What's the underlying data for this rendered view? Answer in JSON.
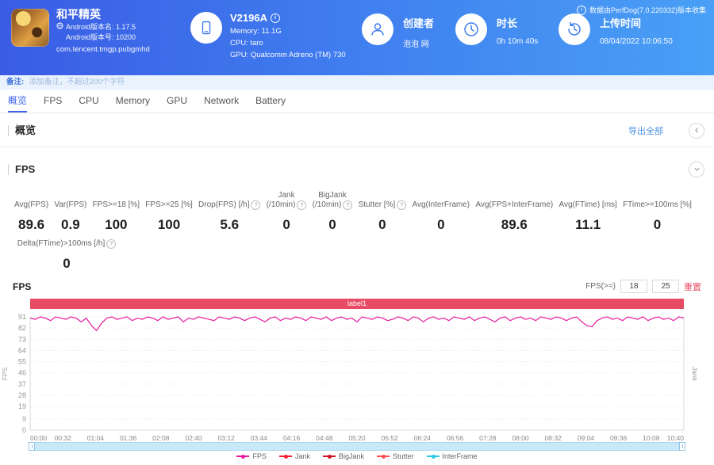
{
  "collector_note": "数据由PerfDog(7.0.220332)版本收集",
  "header": {
    "app": {
      "title": "和平精英",
      "version_name": "Android版本名: 1.17.5",
      "version_code": "Android版本号: 10200",
      "package": "com.tencent.tmgp.pubgmhd"
    },
    "device": {
      "model": "V2196A",
      "memory": "Memory: 11.1G",
      "cpu": "CPU: taro",
      "gpu": "GPU: Qualcomm Adreno (TM) 730"
    },
    "creator": {
      "label": "创建者",
      "value": "泡泡 网"
    },
    "duration": {
      "label": "时长",
      "value": "0h 10m 40s"
    },
    "upload_time": {
      "label": "上传时间",
      "value": "08/04/2022 10:06:50"
    }
  },
  "note_bar": {
    "label": "备注:",
    "placeholder": "添加备注，不超过200个字符"
  },
  "tabs": {
    "items": [
      "概览",
      "FPS",
      "CPU",
      "Memory",
      "GPU",
      "Network",
      "Battery"
    ],
    "active": "概览"
  },
  "overview_section": {
    "title": "概览",
    "export_label": "导出全部"
  },
  "fps_section": {
    "title": "FPS",
    "metrics": [
      {
        "label": "Avg(FPS)",
        "value": "89.6"
      },
      {
        "label": "Var(FPS)",
        "value": "0.9"
      },
      {
        "label": "FPS>=18 [%]",
        "value": "100"
      },
      {
        "label": "FPS>=25 [%]",
        "value": "100"
      },
      {
        "label": "Drop(FPS) [/h]",
        "help": true,
        "value": "5.6"
      },
      {
        "label": "Jank",
        "label2": "(/10min)",
        "help": true,
        "value": "0"
      },
      {
        "label": "BigJank",
        "label2": "(/10min)",
        "help": true,
        "value": "0"
      },
      {
        "label": "Stutter [%]",
        "help": true,
        "value": "0"
      },
      {
        "label": "Avg(InterFrame)",
        "value": "0"
      },
      {
        "label": "Avg(FPS+InterFrame)",
        "value": "89.6"
      },
      {
        "label": "Avg(FTime) [ms]",
        "value": "11.1"
      },
      {
        "label": "FTime>=100ms [%]",
        "value": "0"
      }
    ],
    "extra_metric": {
      "label": "Delta(FTime)>100ms [/h]",
      "help": true,
      "value": "0"
    }
  },
  "chart_controls": {
    "chart_title": "FPS",
    "threshold_label": "FPS(>=)",
    "threshold_low": "18",
    "threshold_high": "25",
    "reset_label": "重置"
  },
  "chart_data": {
    "type": "line",
    "title": "FPS",
    "banner_label": "label1",
    "y_axis_left_label": "FPS",
    "y_axis_right_label": "Jank",
    "y_ticks": [
      91,
      82,
      73,
      64,
      55,
      46,
      37,
      28,
      19,
      9,
      0
    ],
    "ylim": [
      0,
      91
    ],
    "x_ticks": [
      "00:00",
      "00:32",
      "01:04",
      "01:36",
      "02:08",
      "02:40",
      "03:12",
      "03:44",
      "04:16",
      "04:48",
      "05:20",
      "05:52",
      "06:24",
      "06:56",
      "07:28",
      "08:00",
      "08:32",
      "09:04",
      "09:36",
      "10:08",
      "10:40"
    ],
    "x_range_seconds": [
      0,
      640
    ],
    "sample_step_seconds": 5,
    "grid": true,
    "legend_position": "bottom",
    "series": [
      {
        "name": "FPS",
        "color": "#e8189d",
        "values": [
          90,
          89,
          91,
          90,
          88,
          91,
          90,
          89,
          91,
          90,
          87,
          90,
          84,
          80,
          86,
          90,
          91,
          89,
          90,
          91,
          88,
          90,
          89,
          91,
          90,
          88,
          91,
          89,
          90,
          91,
          87,
          90,
          89,
          91,
          90,
          89,
          88,
          91,
          90,
          89,
          91,
          90,
          88,
          90,
          91,
          89,
          87,
          90,
          91,
          88,
          90,
          89,
          91,
          90,
          88,
          91,
          90,
          89,
          91,
          88,
          90,
          91,
          89,
          90,
          87,
          91,
          90,
          89,
          91,
          90,
          88,
          89,
          91,
          90,
          88,
          91,
          90,
          87,
          90,
          91,
          89,
          90,
          88,
          91,
          90,
          89,
          91,
          88,
          90,
          91,
          89,
          87,
          90,
          91,
          88,
          90,
          91,
          89,
          90,
          88,
          91,
          90,
          89,
          91,
          90,
          88,
          90,
          91,
          87,
          84,
          83,
          88,
          90,
          91,
          89,
          90,
          88,
          91,
          90,
          89,
          91,
          88,
          90,
          91,
          89,
          90,
          88,
          91,
          90
        ]
      },
      {
        "name": "Jank",
        "color": "#f5222d",
        "values": []
      },
      {
        "name": "BigJank",
        "color": "#cf1322",
        "values": []
      },
      {
        "name": "Stutter",
        "color": "#ff4d4f",
        "values": []
      },
      {
        "name": "InterFrame",
        "color": "#2bc8e4",
        "values": []
      }
    ]
  }
}
